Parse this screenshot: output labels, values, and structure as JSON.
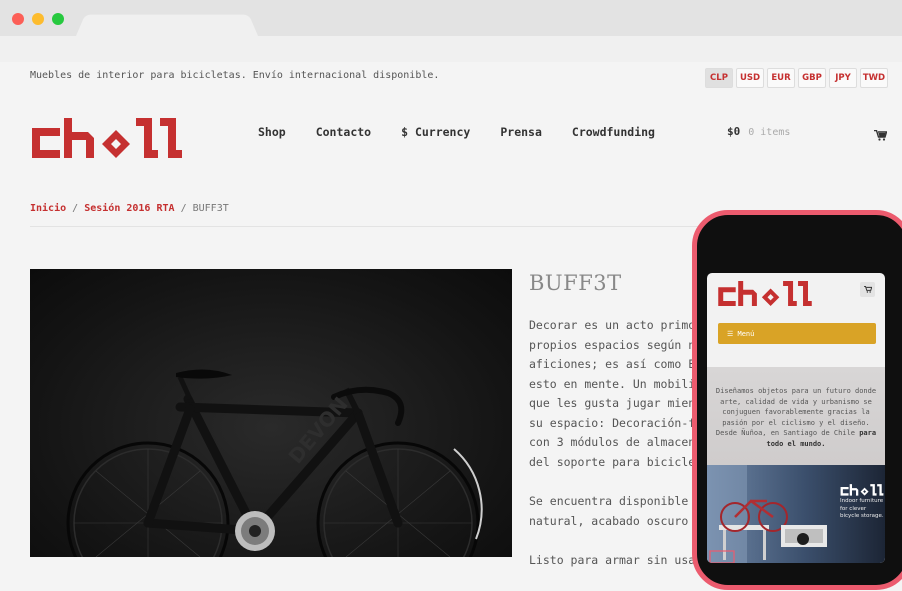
{
  "browser": {
    "tab_title": ""
  },
  "header": {
    "tagline": "Muebles de interior para bicicletas. Envío internacional disponible.",
    "currencies": [
      {
        "label": "CLP",
        "active": true
      },
      {
        "label": "USD",
        "active": false
      },
      {
        "label": "EUR",
        "active": false
      },
      {
        "label": "GBP",
        "active": false
      },
      {
        "label": "JPY",
        "active": false
      },
      {
        "label": "TWD",
        "active": false
      }
    ],
    "logo_text": "Choll",
    "brand_color": "#c53030",
    "nav": [
      "Shop",
      "Contacto",
      "$ Currency",
      "Prensa",
      "Crowdfunding"
    ],
    "cart_amount": "$0",
    "cart_items": "0 items",
    "cart_icon": "shopping-cart-icon"
  },
  "breadcrumb": {
    "home": "Inicio",
    "category": "Sesión 2016 RTA",
    "current": "BUFF3T",
    "separator": "/"
  },
  "product": {
    "title": "BUFF3T",
    "description": [
      "Decorar es un acto primo",
      "propios espacios según n",
      "aficiones; es así como E",
      "esto en mente. Un mobili",
      "que les gusta jugar mien",
      "su espacio: Decoración-f",
      "con 3 módulos de almacen",
      "del soporte para bicicle"
    ],
    "description2": [
      "Se encuentra disponible",
      "natural, acabado oscuro"
    ],
    "description3": [
      "Listo para armar sin usa"
    ],
    "frame_text": "DEVON"
  },
  "mobile": {
    "logo_text": "Choll",
    "menu_label": "☰ Menú",
    "hero_text": "Diseñamos objetos para un futuro donde arte, calidad de vida y urbanismo se conjuguen favorablemente gracias la pasión por el ciclismo y el diseño. Desde Ñuñoa, en Santiago de Chile",
    "hero_bold": "para todo el mundo.",
    "banner_logo": "Choll",
    "banner_text": "Indoor furniture for clever bicycle storage.",
    "menu_color": "#d9a326",
    "frame_color": "#ec5b6e"
  }
}
